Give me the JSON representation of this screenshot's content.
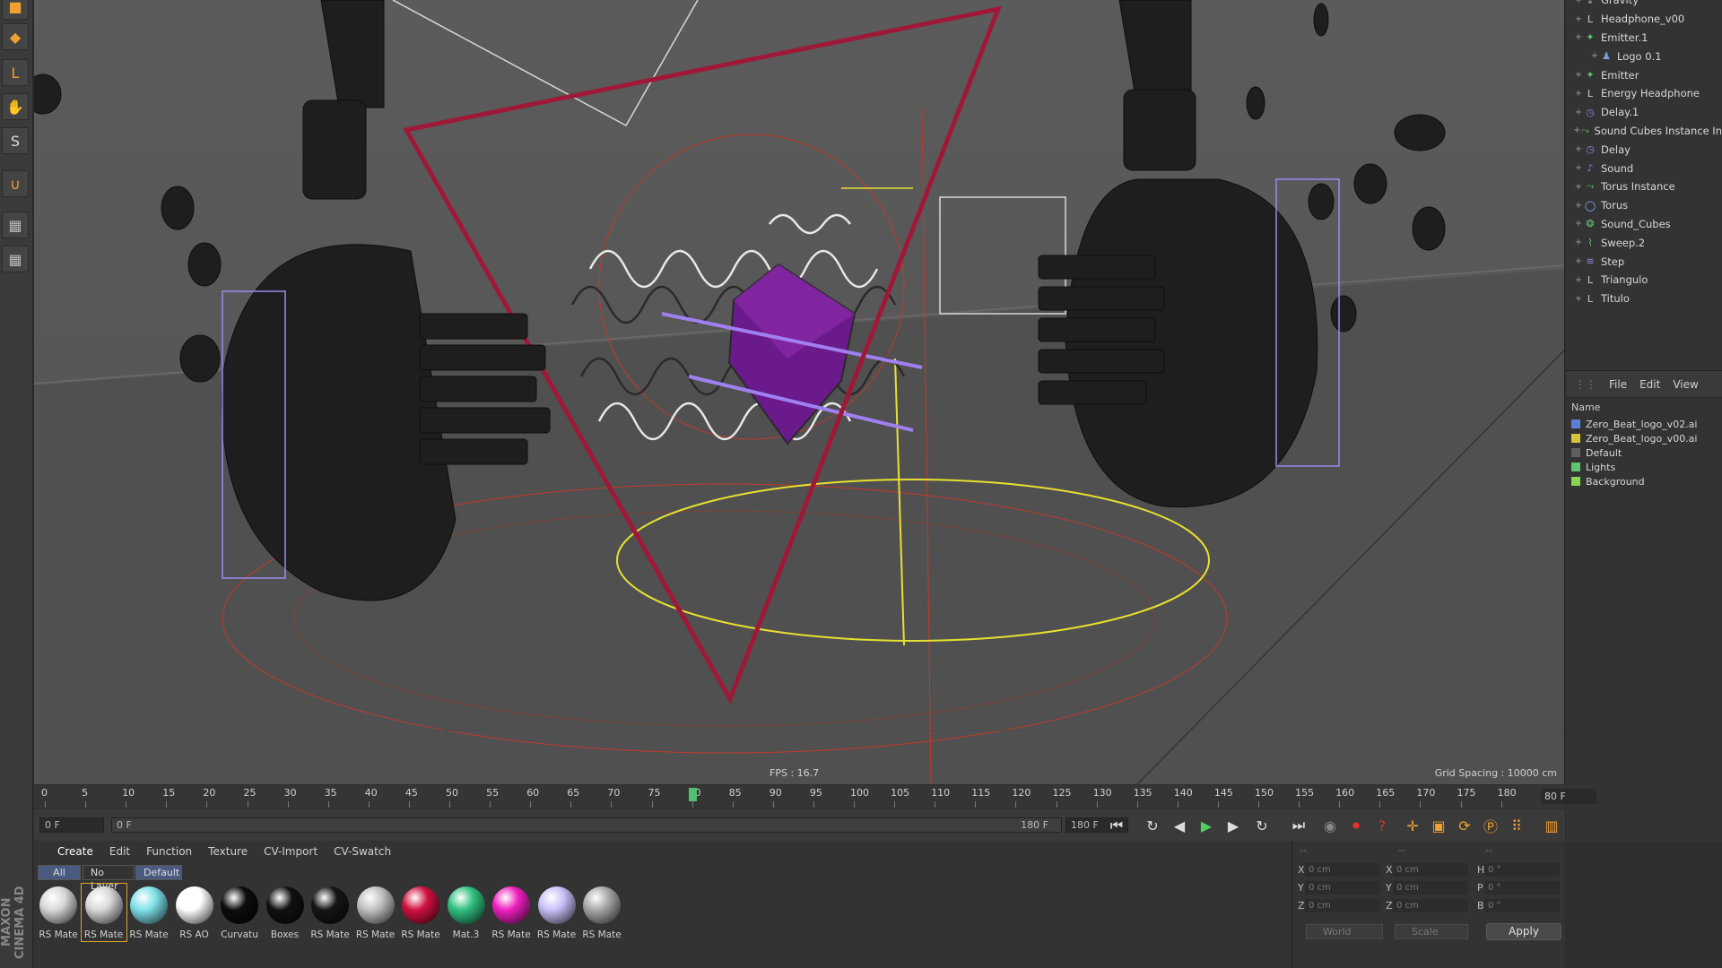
{
  "app": {
    "brand": "MAXON CINEMA 4D"
  },
  "left_toolbar": [
    {
      "icon": "cube-icon"
    },
    {
      "icon": "cube-primitive-icon"
    },
    {
      "icon": "axis-icon"
    },
    {
      "icon": "hand-icon"
    },
    {
      "icon": "s-icon"
    },
    {
      "icon": "magnet-icon"
    },
    {
      "icon": "checker-lock-icon"
    },
    {
      "icon": "checker-icon"
    }
  ],
  "viewport": {
    "fps": "FPS : 16.7",
    "grid_spacing": "Grid Spacing : 10000 cm"
  },
  "object_manager": {
    "items": [
      {
        "name": "Gravity",
        "indent": 1,
        "icon": "gravity-icon",
        "color": "#aaaaaa"
      },
      {
        "name": "Headphone_v00",
        "indent": 1,
        "icon": "null-icon",
        "color": "#cccccc"
      },
      {
        "name": "Emitter.1",
        "indent": 1,
        "icon": "emitter-icon",
        "color": "#5ec46e"
      },
      {
        "name": "Logo 0.1",
        "indent": 2,
        "icon": "figure-icon",
        "color": "#7aa0e0"
      },
      {
        "name": "Emitter",
        "indent": 1,
        "icon": "emitter-icon",
        "color": "#5ec46e"
      },
      {
        "name": "Energy Headphone",
        "indent": 1,
        "icon": "null-icon",
        "color": "#cccccc"
      },
      {
        "name": "Delay.1",
        "indent": 1,
        "icon": "delay-icon",
        "color": "#8a8ae0"
      },
      {
        "name": "Sound Cubes Instance In",
        "indent": 1,
        "icon": "instance-icon",
        "color": "#5ec46e"
      },
      {
        "name": "Delay",
        "indent": 1,
        "icon": "delay-icon",
        "color": "#8a8ae0"
      },
      {
        "name": "Sound",
        "indent": 1,
        "icon": "sound-icon",
        "color": "#8a8ae0"
      },
      {
        "name": "Torus Instance",
        "indent": 1,
        "icon": "instance-icon",
        "color": "#5ec46e"
      },
      {
        "name": "Torus",
        "indent": 1,
        "icon": "torus-icon",
        "color": "#7ab0ff"
      },
      {
        "name": "Sound_Cubes",
        "indent": 1,
        "icon": "cloner-icon",
        "color": "#5ec46e"
      },
      {
        "name": "Sweep.2",
        "indent": 1,
        "icon": "sweep-icon",
        "color": "#5ec46e"
      },
      {
        "name": "Step",
        "indent": 1,
        "icon": "step-icon",
        "color": "#8a8ae0"
      },
      {
        "name": "Triangulo",
        "indent": 1,
        "icon": "null-icon",
        "color": "#cccccc"
      },
      {
        "name": "Titulo",
        "indent": 1,
        "icon": "null-icon",
        "color": "#cccccc"
      }
    ]
  },
  "layer_manager": {
    "menu": [
      "File",
      "Edit",
      "View"
    ],
    "column_header": "Name",
    "layers": [
      {
        "name": "Zero_Beat_logo_v02.ai",
        "color": "#5b7fd6"
      },
      {
        "name": "Zero_Beat_logo_v00.ai",
        "color": "#d8c43a"
      },
      {
        "name": "Default",
        "color": "#606060"
      },
      {
        "name": "Lights",
        "color": "#5ec46e"
      },
      {
        "name": "Background",
        "color": "#8ad64e"
      }
    ]
  },
  "timeline": {
    "ticks": [
      "0",
      "5",
      "10",
      "15",
      "20",
      "25",
      "30",
      "35",
      "40",
      "45",
      "50",
      "55",
      "60",
      "65",
      "70",
      "75",
      "80",
      "85",
      "90",
      "95",
      "100",
      "105",
      "110",
      "115",
      "120",
      "125",
      "130",
      "135",
      "140",
      "145",
      "150",
      "155",
      "160",
      "165",
      "170",
      "175",
      "180"
    ],
    "current_frame": 80,
    "current_frame_label": "80",
    "end_frame_field": "80 F"
  },
  "transport": {
    "start_field": "0 F",
    "range_start": "0 F",
    "range_end": "180 F",
    "end_field": "180 F",
    "buttons": [
      {
        "icon": "go-to-start-icon",
        "glyph": "⏮"
      },
      {
        "icon": "loop-icon",
        "glyph": "↻"
      },
      {
        "icon": "step-back-icon",
        "glyph": "◀"
      },
      {
        "icon": "play-icon",
        "glyph": "▶"
      },
      {
        "icon": "step-forward-icon",
        "glyph": "▶"
      },
      {
        "icon": "loop-forward-icon",
        "glyph": "↻"
      },
      {
        "icon": "go-to-end-icon",
        "glyph": "⏭"
      }
    ]
  },
  "material_manager": {
    "menu": [
      "Create",
      "Edit",
      "Function",
      "Texture",
      "CV-Import",
      "CV-Swatch"
    ],
    "filters": [
      "All",
      "No Layer",
      "Default"
    ],
    "materials": [
      {
        "label": "RS Mate",
        "color": "#d8d8d8"
      },
      {
        "label": "RS Mate",
        "color": "#d8d8d8"
      },
      {
        "label": "RS Mate",
        "color": "#7ee0e8"
      },
      {
        "label": "RS AO",
        "color": "#ffffff"
      },
      {
        "label": "Curvatu",
        "color": "#0c0c0c"
      },
      {
        "label": "Boxes",
        "color": "#111111"
      },
      {
        "label": "RS Mate",
        "color": "#151515"
      },
      {
        "label": "RS Mate",
        "color": "#c0c0c0"
      },
      {
        "label": "RS Mate",
        "color": "#d01040"
      },
      {
        "label": "Mat.3",
        "color": "#30c080"
      },
      {
        "label": "RS Mate",
        "color": "#f020c0"
      },
      {
        "label": "RS Mate",
        "color": "#c8c0f8"
      },
      {
        "label": "RS Mate",
        "color": "#a8a8a8"
      }
    ]
  },
  "coordinates": {
    "header": [
      "--",
      "--",
      "--"
    ],
    "rows": [
      {
        "a": "X",
        "a_val": "0 cm",
        "b": "X",
        "b_val": "0 cm",
        "c": "H",
        "c_val": "0 °"
      },
      {
        "a": "Y",
        "a_val": "0 cm",
        "b": "Y",
        "b_val": "0 cm",
        "c": "P",
        "c_val": "0 °"
      },
      {
        "a": "Z",
        "a_val": "0 cm",
        "b": "Z",
        "b_val": "0 cm",
        "c": "B",
        "c_val": "0 °"
      }
    ],
    "space": "World",
    "mode": "Scale",
    "apply": "Apply"
  }
}
